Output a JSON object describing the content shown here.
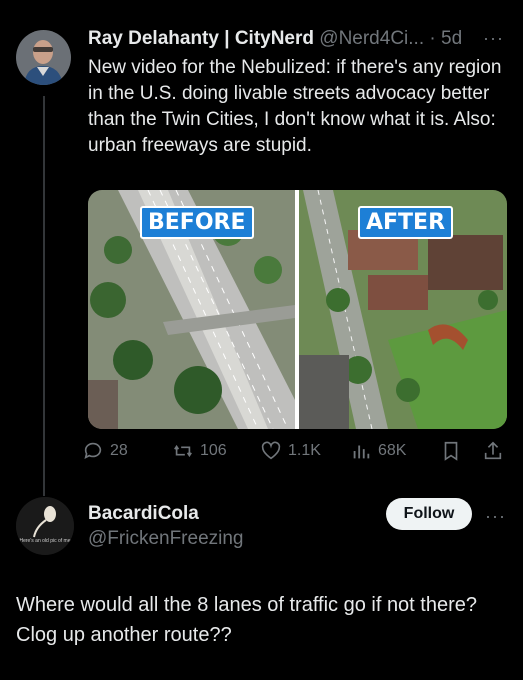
{
  "tweet": {
    "author_name": "Ray Delahanty | CityNerd",
    "handle": "@Nerd4Ci...",
    "time": "· 5d",
    "text": "New video for the Nebulized: if there's any region in the U.S. doing livable streets advocacy better than the Twin Cities, I don't know what it is. Also: urban freeways are stupid.",
    "media": {
      "before_label": "BEFORE",
      "after_label": "AFTER"
    },
    "actions": {
      "replies": "28",
      "retweets": "106",
      "likes": "1.1K",
      "views": "68K"
    },
    "more": "···"
  },
  "reply": {
    "author_name": "BacardiCola",
    "handle": "@FrickenFreezing",
    "follow_label": "Follow",
    "more": "···",
    "avatar_caption": "Here's an old pic of me",
    "text": "Where would all the 8 lanes of traffic go if not there?   Clog up another route??"
  },
  "colors": {
    "background": "#000000",
    "text": "#e7e9ea",
    "muted": "#71767b",
    "follow_bg": "#eff3f4",
    "label_bg": "#1d7fd6"
  }
}
